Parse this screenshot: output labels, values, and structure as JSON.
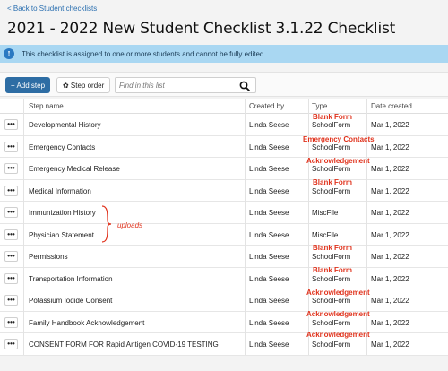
{
  "back_link": "< Back to Student checklists",
  "title": "2021 - 2022 New Student Checklist 3.1.22 Checklist",
  "banner": {
    "icon": "info-icon",
    "text": "This checklist is assigned to one or more students and cannot be fully edited."
  },
  "toolbar": {
    "add_label": "+ Add step",
    "order_label": "✿ Step order",
    "search_placeholder": "Find in this list",
    "search_icon": "search-icon"
  },
  "columns": {
    "name": "Step name",
    "created_by": "Created by",
    "type": "Type",
    "date": "Date created"
  },
  "rows": [
    {
      "name": "Developmental History",
      "created_by": "Linda Seese",
      "type": "SchoolForm",
      "date": "Mar 1, 2022"
    },
    {
      "name": "Emergency Contacts",
      "created_by": "Linda Seese",
      "type": "SchoolForm",
      "date": "Mar 1, 2022"
    },
    {
      "name": "Emergency Medical Release",
      "created_by": "Linda Seese",
      "type": "SchoolForm",
      "date": "Mar 1, 2022"
    },
    {
      "name": "Medical Information",
      "created_by": "Linda Seese",
      "type": "SchoolForm",
      "date": "Mar 1, 2022"
    },
    {
      "name": "Immunization History",
      "created_by": "Linda Seese",
      "type": "MiscFile",
      "date": "Mar 1, 2022"
    },
    {
      "name": "Physician Statement",
      "created_by": "Linda Seese",
      "type": "MiscFile",
      "date": "Mar 1, 2022"
    },
    {
      "name": "Permissions",
      "created_by": "Linda Seese",
      "type": "SchoolForm",
      "date": "Mar 1, 2022"
    },
    {
      "name": "Transportation Information",
      "created_by": "Linda Seese",
      "type": "SchoolForm",
      "date": "Mar 1, 2022"
    },
    {
      "name": "Potassium Iodide Consent",
      "created_by": "Linda Seese",
      "type": "SchoolForm",
      "date": "Mar 1, 2022"
    },
    {
      "name": "Family Handbook Acknowledgement",
      "created_by": "Linda Seese",
      "type": "SchoolForm",
      "date": "Mar 1, 2022"
    },
    {
      "name": "CONSENT FORM FOR Rapid Antigen COVID-19 TESTING",
      "created_by": "Linda Seese",
      "type": "SchoolForm",
      "date": "Mar 1, 2022"
    }
  ],
  "annotations": {
    "r0": "Blank Form",
    "r1": "Emergency Contacts",
    "r2": "Acknowledgement",
    "r3": "Blank Form",
    "uploads": "uploads",
    "r6": "Blank Form",
    "r7": "Blank Form",
    "r8": "Acknowledgement",
    "r9": "Acknowledgement",
    "r10": "Acknowledgement"
  },
  "colors": {
    "accent": "#2e6da4",
    "banner": "#a9d7f2",
    "annotation": "#e0321c"
  }
}
